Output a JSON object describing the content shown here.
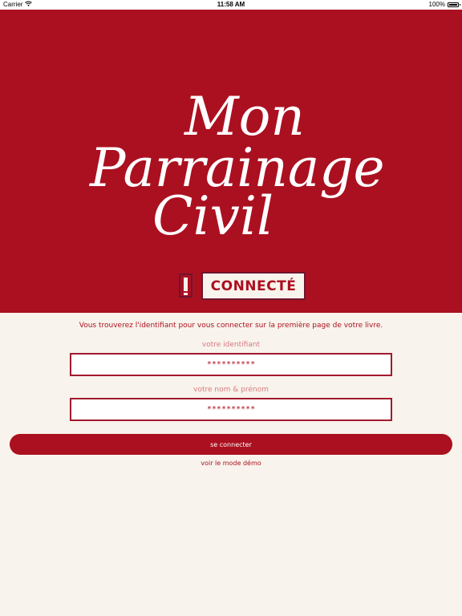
{
  "status_bar": {
    "carrier": "Carrier",
    "time": "11:58 AM",
    "battery": "100%",
    "icons": [
      "wifi-icon",
      "battery-icon"
    ]
  },
  "hero": {
    "background_color": "#ab1020",
    "logo_lines": [
      "Mon",
      "Parrainage",
      "Civil"
    ],
    "badge_icon": "exclamation-icon",
    "badge_label": "CONNECTÉ"
  },
  "form": {
    "instruction": "Vous trouverez l'identifiant pour vous connecter sur la première page de votre livre.",
    "identifier_label": "votre identifiant",
    "identifier_value": "**********",
    "name_label": "votre nom & prénom",
    "name_value": "**********",
    "submit_label": "se connecter",
    "demo_link": "voir le mode démo"
  },
  "colors": {
    "accent": "#ab1020",
    "background": "#f8f3ec",
    "label": "#d87a80"
  }
}
